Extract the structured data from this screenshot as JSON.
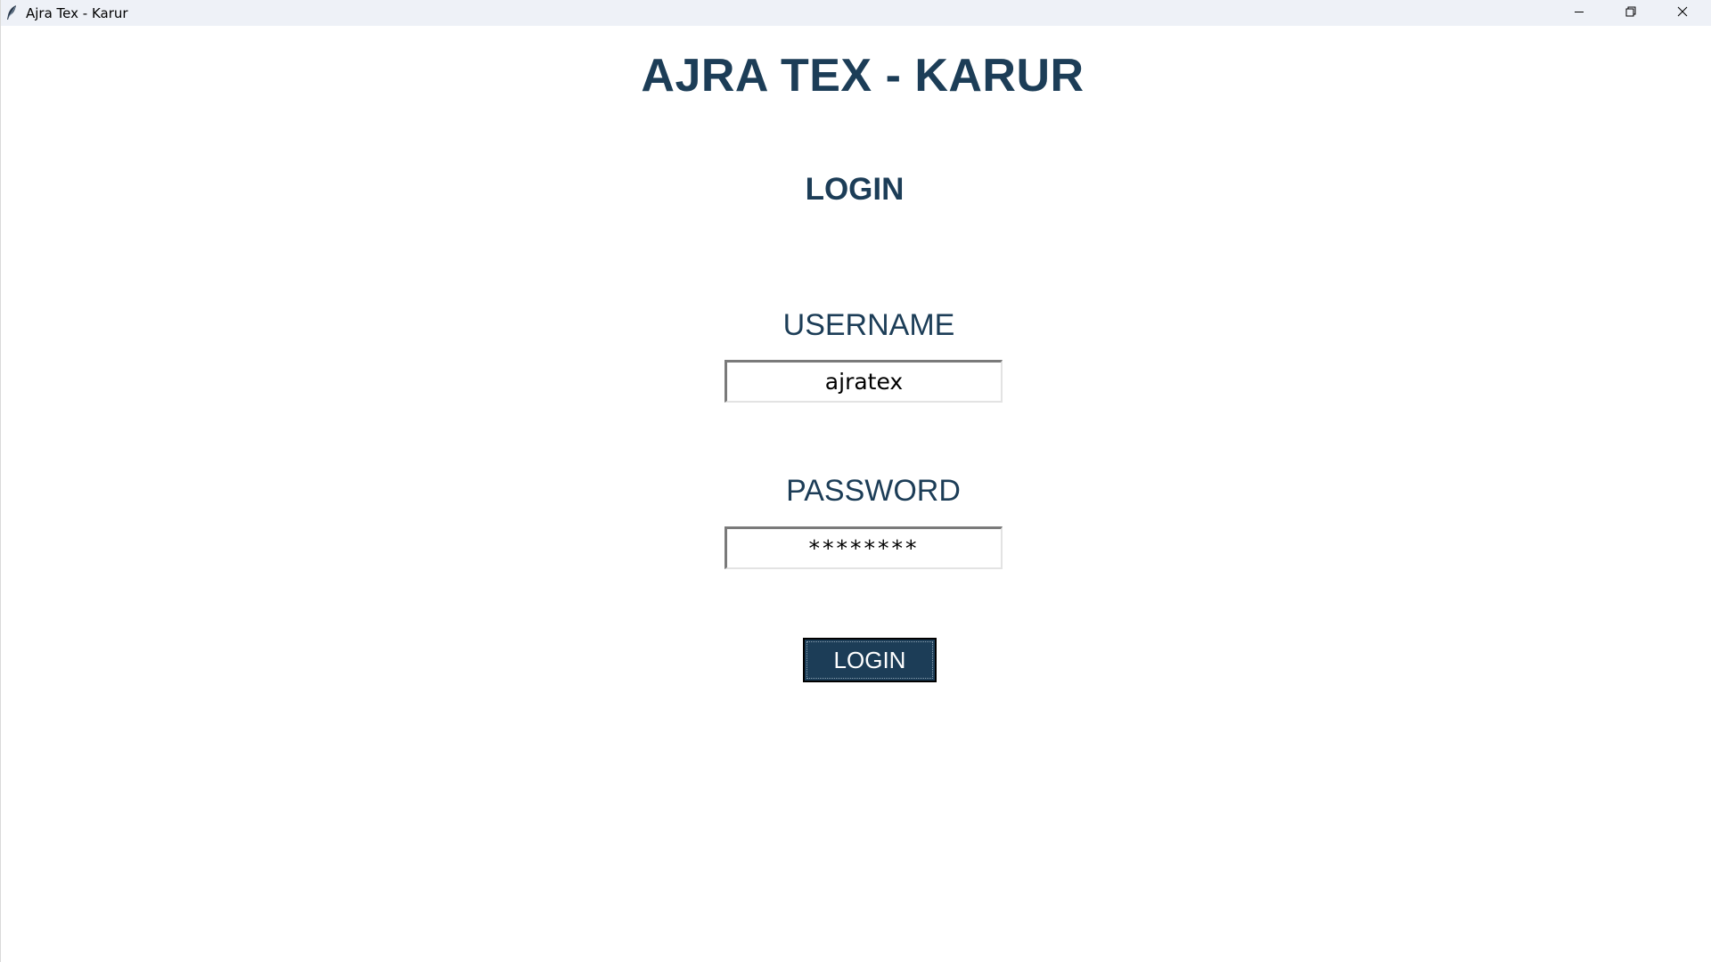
{
  "window": {
    "title": "Ajra Tex - Karur",
    "icons": {
      "app": "feather-icon",
      "minimize": "minimize-icon",
      "maximize": "restore-icon",
      "close": "close-icon"
    }
  },
  "main": {
    "app_title": "AJRA TEX - KARUR",
    "heading": "LOGIN",
    "username_label": "USERNAME",
    "username_value": "ajratex",
    "password_label": "PASSWORD",
    "password_value": "********",
    "login_button": "LOGIN"
  },
  "colors": {
    "primary": "#1c3d57",
    "titlebar": "#eef1f7",
    "background": "#ffffff"
  }
}
